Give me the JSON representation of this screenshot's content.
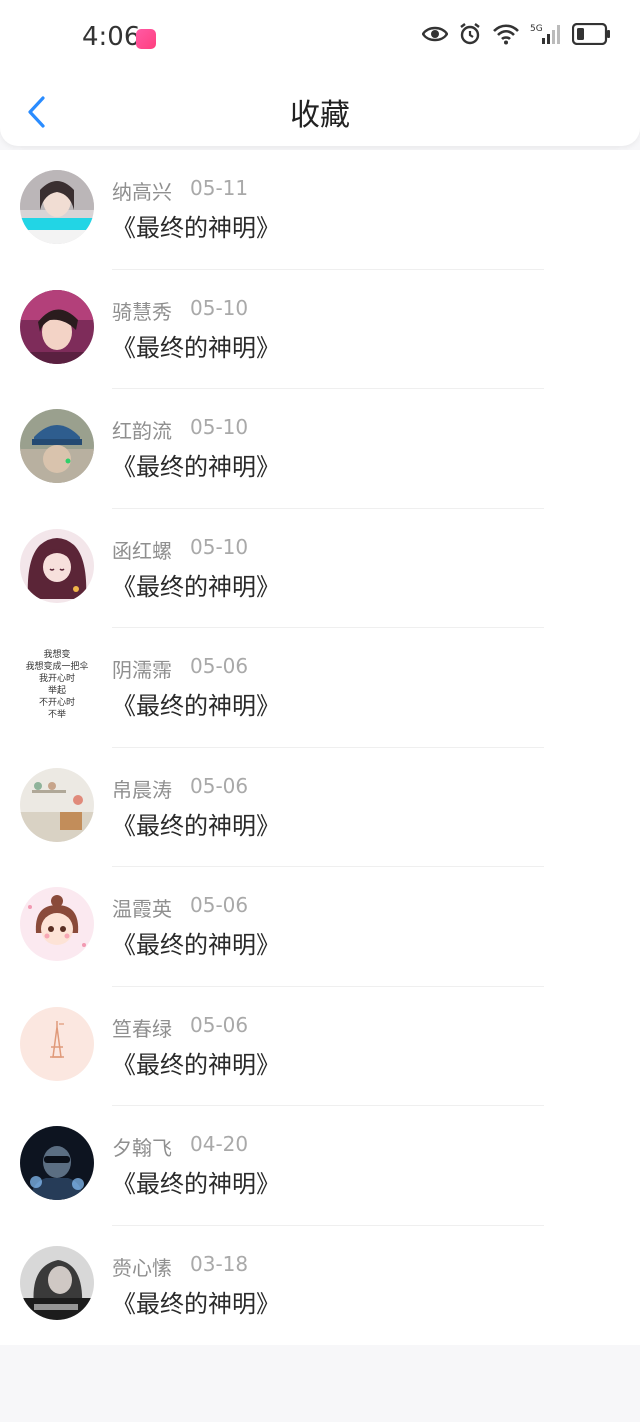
{
  "status_bar": {
    "time": "4:06",
    "icons": [
      "app-badge-icon",
      "eye-icon",
      "alarm-icon",
      "wifi-icon",
      "5g-signal-icon",
      "battery-icon"
    ]
  },
  "header": {
    "title": "收藏",
    "back_icon": "chevron-left-icon"
  },
  "colors": {
    "accent": "#2a8cff",
    "background": "#f7f7f9"
  },
  "favorites": [
    {
      "name": "纳高兴",
      "date": "05-11",
      "title": "《最终的神明》",
      "avatar": "photo-avatar"
    },
    {
      "name": "骑慧秀",
      "date": "05-10",
      "title": "《最终的神明》",
      "avatar": "photo-avatar"
    },
    {
      "name": "红韵流",
      "date": "05-10",
      "title": "《最终的神明》",
      "avatar": "photo-avatar"
    },
    {
      "name": "函红螺",
      "date": "05-10",
      "title": "《最终的神明》",
      "avatar": "anime-avatar"
    },
    {
      "name": "阴濡霈",
      "date": "05-06",
      "title": "《最终的神明》",
      "avatar": "text-avatar",
      "avatar_text": [
        "我想变",
        "我想变成一把伞",
        "我开心时",
        "举起",
        "不开心时",
        "不举"
      ]
    },
    {
      "name": "帛晨涛",
      "date": "05-06",
      "title": "《最终的神明》",
      "avatar": "photo-avatar"
    },
    {
      "name": "温霞英",
      "date": "05-06",
      "title": "《最终的神明》",
      "avatar": "anime-avatar"
    },
    {
      "name": "笪春绿",
      "date": "05-06",
      "title": "《最终的神明》",
      "avatar": "eiffel-tower-avatar"
    },
    {
      "name": "夕翰飞",
      "date": "04-20",
      "title": "《最终的神明》",
      "avatar": "photo-avatar"
    },
    {
      "name": "赍心愫",
      "date": "03-18",
      "title": "《最终的神明》",
      "avatar": "photo-avatar"
    }
  ]
}
